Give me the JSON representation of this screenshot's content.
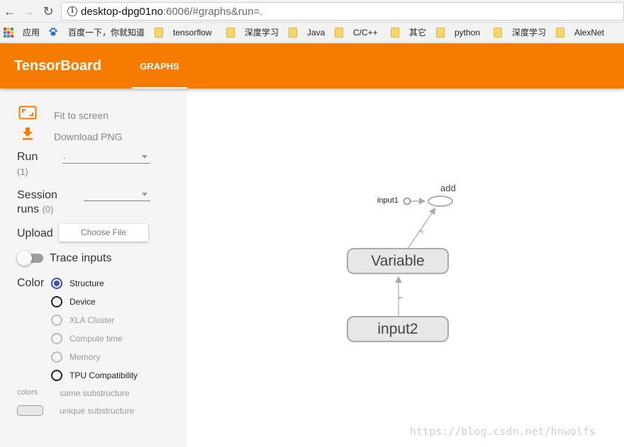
{
  "browser": {
    "url_host": "desktop-dpg01no",
    "url_rest": ":6006/#graphs&run=.",
    "bookmarks": [
      "应用",
      "百度一下，你就知道",
      "tensorflow",
      "深度学习",
      "Java",
      "C/C++",
      "其它",
      "python",
      "深度学习",
      "AlexNet"
    ]
  },
  "header": {
    "title": "TensorBoard",
    "tab": "GRAPHS",
    "color": "#f57c00"
  },
  "sidebar": {
    "fit_to_screen": "Fit to screen",
    "download_png": "Download PNG",
    "run_label": "Run",
    "run_count": "(1)",
    "run_value": ".",
    "session_label_1": "Session",
    "session_label_2": "runs",
    "session_count": "(0)",
    "upload_label": "Upload",
    "choose_file": "Choose File",
    "trace_inputs": "Trace inputs",
    "color_label": "Color",
    "color_options": [
      "Structure",
      "Device",
      "XLA Cluster",
      "Compute time",
      "Memory",
      "TPU Compatibility"
    ],
    "colors_label": "colors",
    "same_substructure": "same substructure",
    "unique_substructure": "unique substructure"
  },
  "graph": {
    "nodes": {
      "add": "add",
      "input1": "input1",
      "variable": "Variable",
      "input2": "input2"
    },
    "edge_labels": [
      "3",
      "3"
    ],
    "watermark": "https://blog.csdn.net/hnwolfs"
  }
}
